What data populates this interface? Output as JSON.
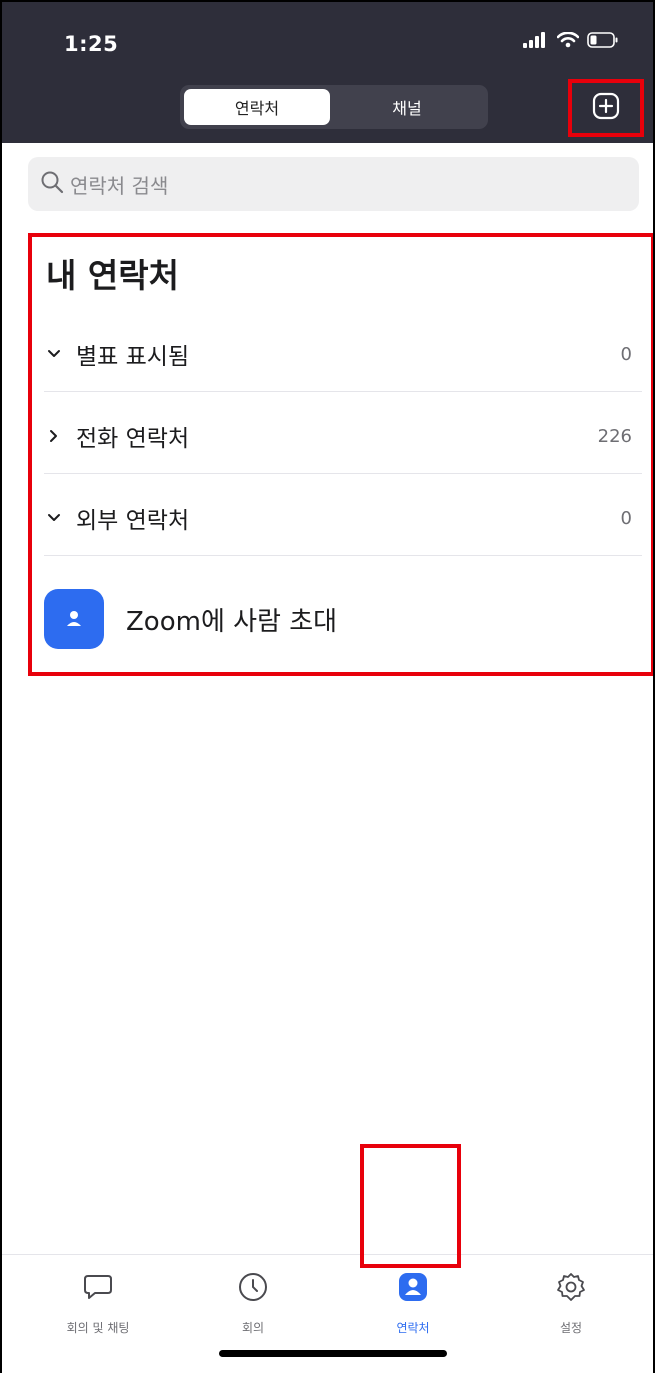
{
  "status_bar": {
    "time": "1:25"
  },
  "segment": {
    "tabs": [
      {
        "label": "연락처",
        "active": true
      },
      {
        "label": "채널",
        "active": false
      }
    ]
  },
  "header": {
    "add_icon": "plus-square-icon"
  },
  "search": {
    "placeholder": "연락처 검색"
  },
  "contacts": {
    "title": "내 연락처",
    "groups": [
      {
        "label": "별표 표시됨",
        "count": "0",
        "expanded": true
      },
      {
        "label": "전화 연락처",
        "count": "226",
        "expanded": false
      },
      {
        "label": "외부 연락처",
        "count": "0",
        "expanded": true
      }
    ],
    "invite_label": "Zoom에 사람 초대"
  },
  "tabbar": {
    "tabs": [
      {
        "label": "회의 및 채팅",
        "icon": "chat-bubble-icon"
      },
      {
        "label": "회의",
        "icon": "clock-icon"
      },
      {
        "label": "연락처",
        "icon": "contact-icon",
        "active": true
      },
      {
        "label": "설정",
        "icon": "gear-icon"
      }
    ]
  },
  "colors": {
    "accent": "#2d6cf0",
    "header_bg": "#2e2e3a",
    "highlight": "#e8000b"
  }
}
